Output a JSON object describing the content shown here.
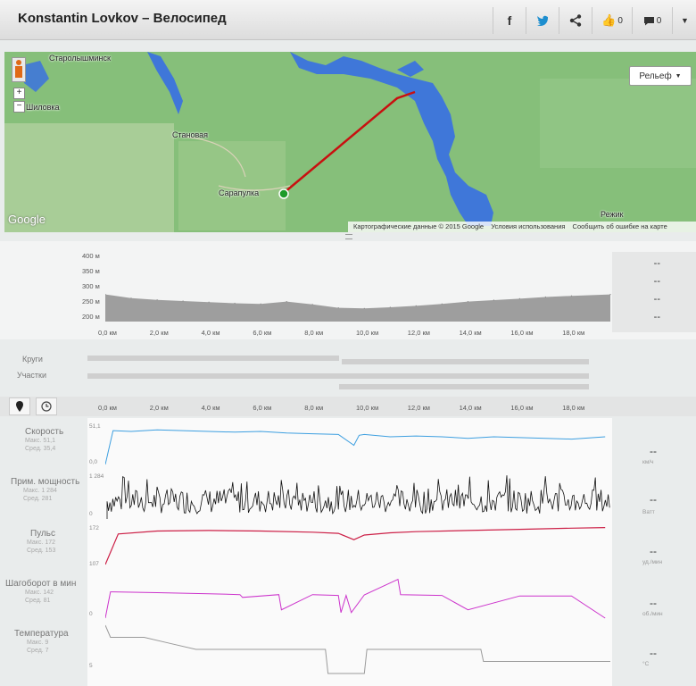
{
  "header": {
    "title": "Konstantin Lovkov – Велосипед",
    "facebook_icon": "f",
    "twitter_icon": "twitter",
    "likes_count": "0",
    "comments_count": "0"
  },
  "map": {
    "relief_label": "Рельеф",
    "labels": {
      "starolyshminsk": "Старолышминск",
      "shilovka": "Шиловка",
      "stanovaya": "Становая",
      "sarapulka": "Сарапулка",
      "rezh": "Режик",
      "google": "Google"
    },
    "attribution": "Картографические данные © 2015 Google",
    "terms": "Условия использования",
    "report": "Сообщить об ошибке на карте"
  },
  "elevation": {
    "y_ticks": [
      "400 м",
      "350 м",
      "300 м",
      "250 м",
      "200 м"
    ],
    "x_ticks": [
      "0,0 км",
      "2,0 км",
      "4,0 км",
      "6,0 км",
      "8,0 км",
      "10,0 км",
      "12,0 км",
      "14,0 км",
      "16,0 км",
      "18,0 км"
    ],
    "side_values": [
      "--",
      "--",
      "--",
      "--"
    ]
  },
  "laps": {
    "krugi_label": "Круги",
    "uchastki_label": "Участки"
  },
  "tracks": {
    "speed": {
      "name": "Скорость",
      "max": "Макс. 51,1",
      "avg": "Сред. 35,4",
      "top": "51,1",
      "bottom": "0,0",
      "value": "--",
      "unit": "км/ч"
    },
    "power": {
      "name": "Прим. мощность",
      "max": "Макс. 1 284",
      "avg": "Сред. 281",
      "top": "1 284",
      "bottom": "0",
      "value": "--",
      "unit": "Ватт"
    },
    "pulse": {
      "name": "Пульс",
      "max": "Макс. 172",
      "avg": "Сред. 153",
      "top": "172",
      "bottom": "107",
      "value": "--",
      "unit": "уд./мин"
    },
    "cadence": {
      "name": "Шагоборот в мин",
      "max": "Макс. 142",
      "avg": "Сред. 81",
      "top": "",
      "bottom": "0",
      "value": "--",
      "unit": "об./мин"
    },
    "temperature": {
      "name": "Температура",
      "max": "Макс. 9",
      "avg": "Сред. 7",
      "top": "",
      "bottom": "5",
      "value": "--",
      "unit": "°С"
    }
  },
  "chart_data": [
    {
      "type": "area",
      "title": "",
      "xlabel": "",
      "ylabel": "",
      "xlim": [
        0,
        19.5
      ],
      "ylim": [
        150,
        400
      ],
      "x": [
        0,
        1,
        2,
        3,
        4,
        5,
        6,
        7,
        8,
        9,
        10,
        11,
        12,
        13,
        14,
        15,
        16,
        17,
        18,
        19.5
      ],
      "y": [
        245,
        232,
        226,
        222,
        218,
        214,
        212,
        220,
        210,
        198,
        196,
        200,
        205,
        212,
        220,
        225,
        230,
        236,
        240,
        245
      ]
    },
    {
      "type": "line",
      "name": "Скорость",
      "ylim": [
        0,
        51.1
      ],
      "x": [
        0,
        0.3,
        1,
        2,
        3,
        4,
        5,
        6,
        7,
        8,
        9,
        9.6,
        9.8,
        10,
        11,
        12,
        13,
        14,
        15,
        16,
        17,
        18,
        19.3
      ],
      "y": [
        0,
        44,
        43,
        45,
        44,
        43,
        42,
        43,
        41,
        40,
        39,
        25,
        38,
        39,
        36,
        37,
        36,
        34,
        36,
        35,
        34,
        33,
        36
      ]
    },
    {
      "type": "line",
      "name": "Пульс",
      "ylim": [
        107,
        172
      ],
      "x": [
        0,
        0.5,
        2,
        4,
        6,
        8,
        9,
        9.6,
        10,
        11,
        12,
        14,
        16,
        18,
        19.3
      ],
      "y": [
        107,
        160,
        165,
        166,
        165,
        163,
        161,
        150,
        158,
        162,
        164,
        166,
        168,
        170,
        171
      ]
    },
    {
      "type": "line",
      "name": "Шагоборот в мин",
      "ylim": [
        0,
        142
      ],
      "x": [
        0,
        0.2,
        2,
        4,
        5.2,
        5.3,
        6.7,
        6.8,
        8,
        9,
        9.1,
        9.3,
        9.5,
        10,
        11.3,
        11.4,
        13,
        14,
        16,
        18,
        19.3
      ],
      "y": [
        0,
        95,
        92,
        88,
        85,
        75,
        85,
        30,
        85,
        82,
        20,
        82,
        20,
        84,
        140,
        85,
        82,
        30,
        80,
        80,
        0
      ]
    },
    {
      "type": "line",
      "name": "Температура",
      "ylim": [
        5,
        9
      ],
      "x": [
        0,
        0.2,
        1.5,
        2.5,
        3.5,
        8.5,
        8.6,
        10,
        10.1,
        14.5,
        14.6,
        19.5
      ],
      "y": [
        9,
        8,
        8,
        7.5,
        7,
        7,
        5,
        5,
        7,
        7,
        6,
        6
      ]
    }
  ]
}
